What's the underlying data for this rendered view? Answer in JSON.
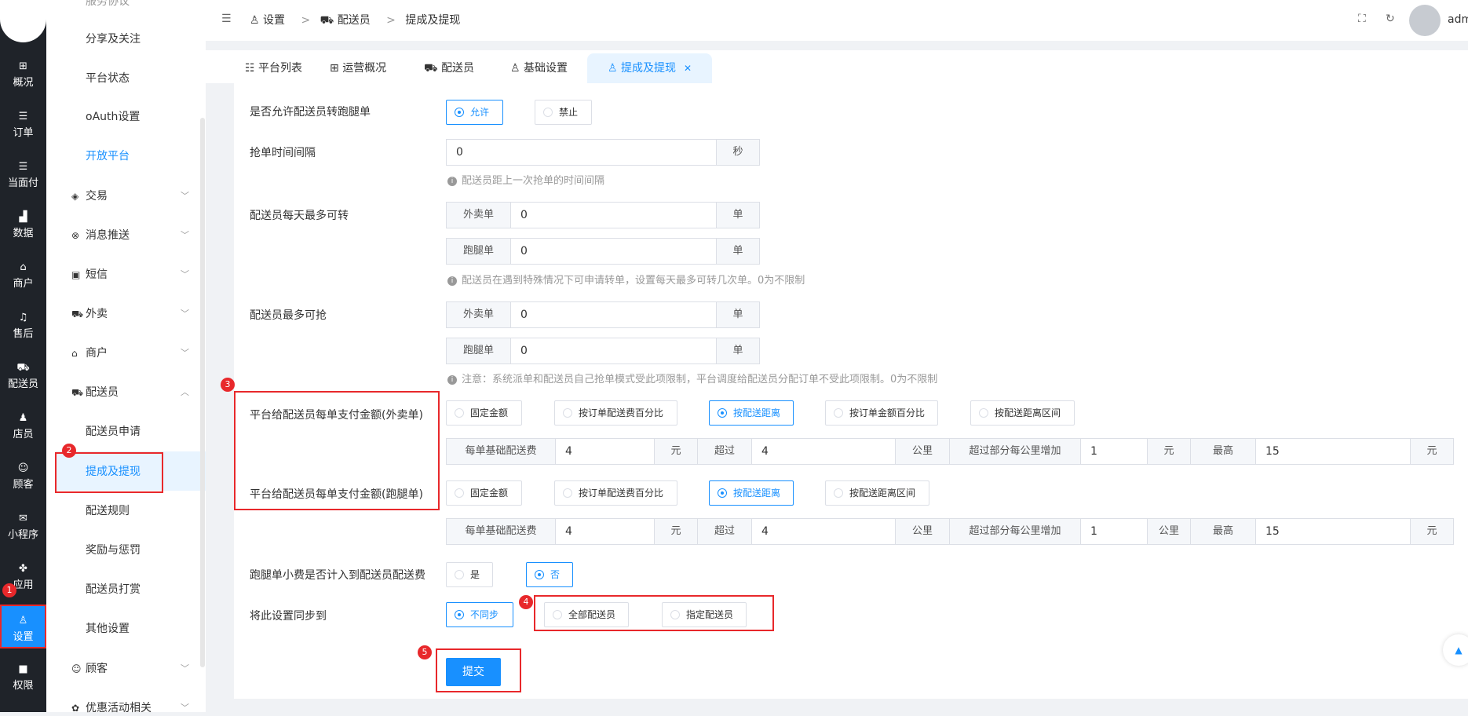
{
  "rail": [
    {
      "key": "overview",
      "icon": "grid-icon",
      "glyph": "⊞",
      "label": "概况"
    },
    {
      "key": "orders",
      "icon": "list-icon",
      "glyph": "☰",
      "label": "订单"
    },
    {
      "key": "inperson",
      "icon": "list-icon",
      "glyph": "☰",
      "label": "当面付"
    },
    {
      "key": "data",
      "icon": "bar-chart-icon",
      "glyph": "▟",
      "label": "数据"
    },
    {
      "key": "merchant",
      "icon": "store-icon",
      "glyph": "⌂",
      "label": "商户"
    },
    {
      "key": "aftersale",
      "icon": "headset-icon",
      "glyph": "♫",
      "label": "售后"
    },
    {
      "key": "courier",
      "icon": "truck-icon",
      "glyph": "⛟",
      "label": "配送员"
    },
    {
      "key": "clerk",
      "icon": "users-icon",
      "glyph": "♟",
      "label": "店员"
    },
    {
      "key": "customer",
      "icon": "smile-icon",
      "glyph": "☺",
      "label": "顾客"
    },
    {
      "key": "miniapp",
      "icon": "wechat-icon",
      "glyph": "✉",
      "label": "小程序"
    },
    {
      "key": "apps",
      "icon": "apps-icon",
      "glyph": "✤",
      "label": "应用"
    },
    {
      "key": "settings",
      "icon": "settings-user-icon",
      "glyph": "♙",
      "label": "设置"
    },
    {
      "key": "perm",
      "icon": "lock-icon",
      "glyph": "■",
      "label": "权限"
    }
  ],
  "side": {
    "top_items": [
      "服务协议",
      "分享及关注",
      "平台状态",
      "oAuth设置",
      "开放平台"
    ],
    "groups": [
      {
        "label": "交易",
        "icon": "trade-icon",
        "glyph": "◈"
      },
      {
        "label": "消息推送",
        "icon": "message-icon",
        "glyph": "⊗"
      },
      {
        "label": "短信",
        "icon": "sms-icon",
        "glyph": "▣"
      },
      {
        "label": "外卖",
        "icon": "truck-icon",
        "glyph": "⛟"
      },
      {
        "label": "商户",
        "icon": "store-icon",
        "glyph": "⌂"
      },
      {
        "label": "配送员",
        "icon": "courier-icon",
        "glyph": "⛟"
      }
    ],
    "courier_items": [
      "配送员申请",
      "提成及提现",
      "配送规则",
      "奖励与惩罚",
      "配送员打赏",
      "其他设置"
    ],
    "bottom_groups": [
      {
        "label": "顾客",
        "icon": "smile-icon",
        "glyph": "☺"
      },
      {
        "label": "优惠活动相关",
        "icon": "gift-icon",
        "glyph": "✿"
      }
    ]
  },
  "breadcrumb": {
    "items": [
      "设置",
      "配送员",
      "提成及提现"
    ],
    "sep": ">"
  },
  "user": {
    "name": "adm"
  },
  "tabs": [
    "平台列表",
    "运营概况",
    "配送员",
    "基础设置",
    "提成及提现"
  ],
  "form": {
    "allow_transfer": {
      "label": "是否允许配送员转跑腿单",
      "options": [
        "允许",
        "禁止"
      ],
      "selected": 0
    },
    "grab_interval": {
      "label": "抢单时间间隔",
      "value": "0",
      "unit": "秒",
      "hint": "配送员距上一次抢单的时间间隔"
    },
    "daily_transfer": {
      "label": "配送员每天最多可转",
      "rows": [
        {
          "prefix": "外卖单",
          "value": "0",
          "unit": "单"
        },
        {
          "prefix": "跑腿单",
          "value": "0",
          "unit": "单"
        }
      ],
      "hint": "配送员在遇到特殊情况下可申请转单，设置每天最多可转几次单。0为不限制"
    },
    "max_grab": {
      "label": "配送员最多可抢",
      "rows": [
        {
          "prefix": "外卖单",
          "value": "0",
          "unit": "单"
        },
        {
          "prefix": "跑腿单",
          "value": "0",
          "unit": "单"
        }
      ],
      "hint": "注意：系统派单和配送员自己抢单模式受此项限制，平台调度给配送员分配订单不受此项限制。0为不限制"
    },
    "pay_takeout": {
      "label": "平台给配送员每单支付金额(外卖单)",
      "options": [
        "固定金额",
        "按订单配送费百分比",
        "按配送距离",
        "按订单金额百分比",
        "按配送距离区间"
      ],
      "selected": 2,
      "fee": {
        "base_label": "每单基础配送费",
        "base": "4",
        "yuan": "元",
        "over_label": "超过",
        "over": "4",
        "km": "公里",
        "extra_label": "超过部分每公里增加",
        "extra": "1",
        "extra_unit": "元",
        "max_label": "最高",
        "max": "15",
        "max_unit": "元"
      }
    },
    "pay_errand": {
      "label": "平台给配送员每单支付金额(跑腿单)",
      "options": [
        "固定金额",
        "按订单配送费百分比",
        "按配送距离",
        "按配送距离区间"
      ],
      "selected": 2,
      "fee": {
        "base_label": "每单基础配送费",
        "base": "4",
        "yuan": "元",
        "over_label": "超过",
        "over": "4",
        "km": "公里",
        "extra_label": "超过部分每公里增加",
        "extra": "1",
        "extra_unit": "公里",
        "max_label": "最高",
        "max": "15",
        "max_unit": "元"
      }
    },
    "tip_included": {
      "label": "跑腿单小费是否计入到配送员配送费",
      "options": [
        "是",
        "否"
      ],
      "selected": 1
    },
    "sync": {
      "label": "将此设置同步到",
      "options": [
        "不同步",
        "全部配送员",
        "指定配送员"
      ],
      "selected": 0
    },
    "submit": "提交"
  },
  "badges": [
    "1",
    "2",
    "3",
    "4",
    "5"
  ],
  "colors": {
    "primary": "#1890ff",
    "highlight": "#e8282b",
    "rail": "#1f2329"
  }
}
